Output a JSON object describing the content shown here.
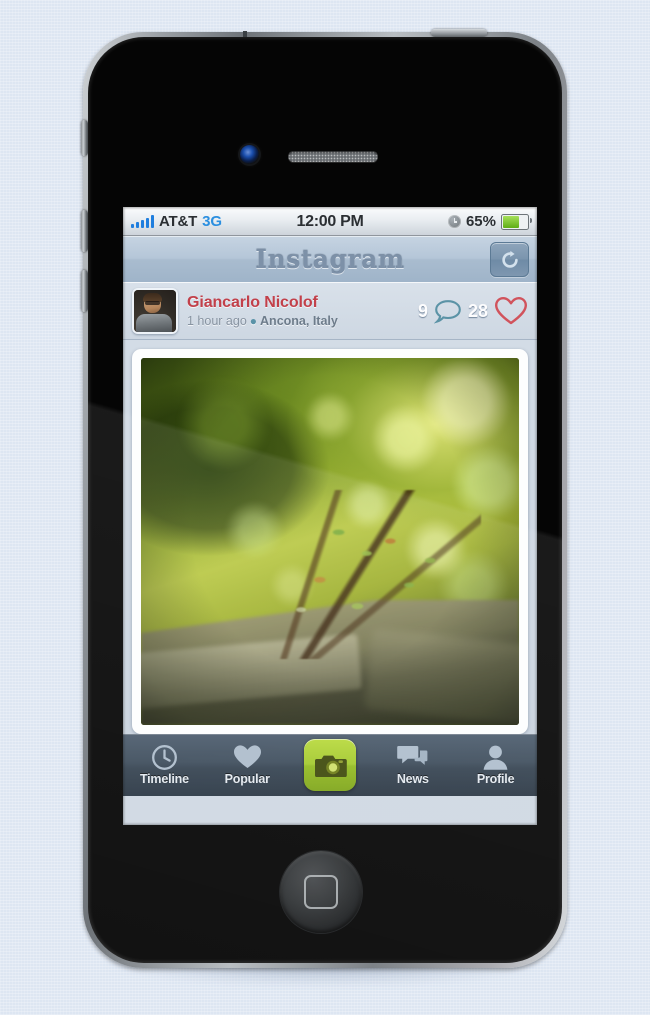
{
  "device": {
    "name": "iPhone 4",
    "front_camera": "front-camera",
    "earpiece": "earpiece-speaker",
    "home_button": "home-button",
    "side_buttons": [
      "mute-switch",
      "volume-up",
      "volume-down",
      "power-button"
    ]
  },
  "status_bar": {
    "signal_bars": 5,
    "carrier": "AT&T",
    "network": "3G",
    "time": "12:00 PM",
    "alarm_icon": "clock-icon",
    "battery_percent": "65%",
    "battery_level": 65,
    "battery_color": "#6fb31a"
  },
  "nav_bar": {
    "title": "Instagram",
    "refresh_icon": "refresh-icon"
  },
  "post": {
    "avatar": "user-avatar",
    "username": "Giancarlo Nicolof",
    "timestamp": "1 hour ago",
    "location_icon": "location-pin-icon",
    "location": "Ancona, Italy",
    "comment_count": "9",
    "comment_icon": "comment-bubble-icon",
    "like_count": "28",
    "like_icon": "heart-icon",
    "photo_alt": "Macro photo of green foliage and branches growing over stone steps"
  },
  "tab_bar": {
    "items": [
      {
        "label": "Timeline",
        "icon": "clock-icon"
      },
      {
        "label": "Popular",
        "icon": "heart-icon"
      },
      {
        "label": "",
        "icon": "camera-icon"
      },
      {
        "label": "News",
        "icon": "chat-bubbles-icon"
      },
      {
        "label": "Profile",
        "icon": "person-icon"
      }
    ]
  },
  "colors": {
    "background": "#dde6f2",
    "username": "#c2404a",
    "accent_green": "#a3c92e",
    "network_blue": "#2b8fe0",
    "heart_red": "#d1535c",
    "bubble_teal": "#5b93a6"
  }
}
